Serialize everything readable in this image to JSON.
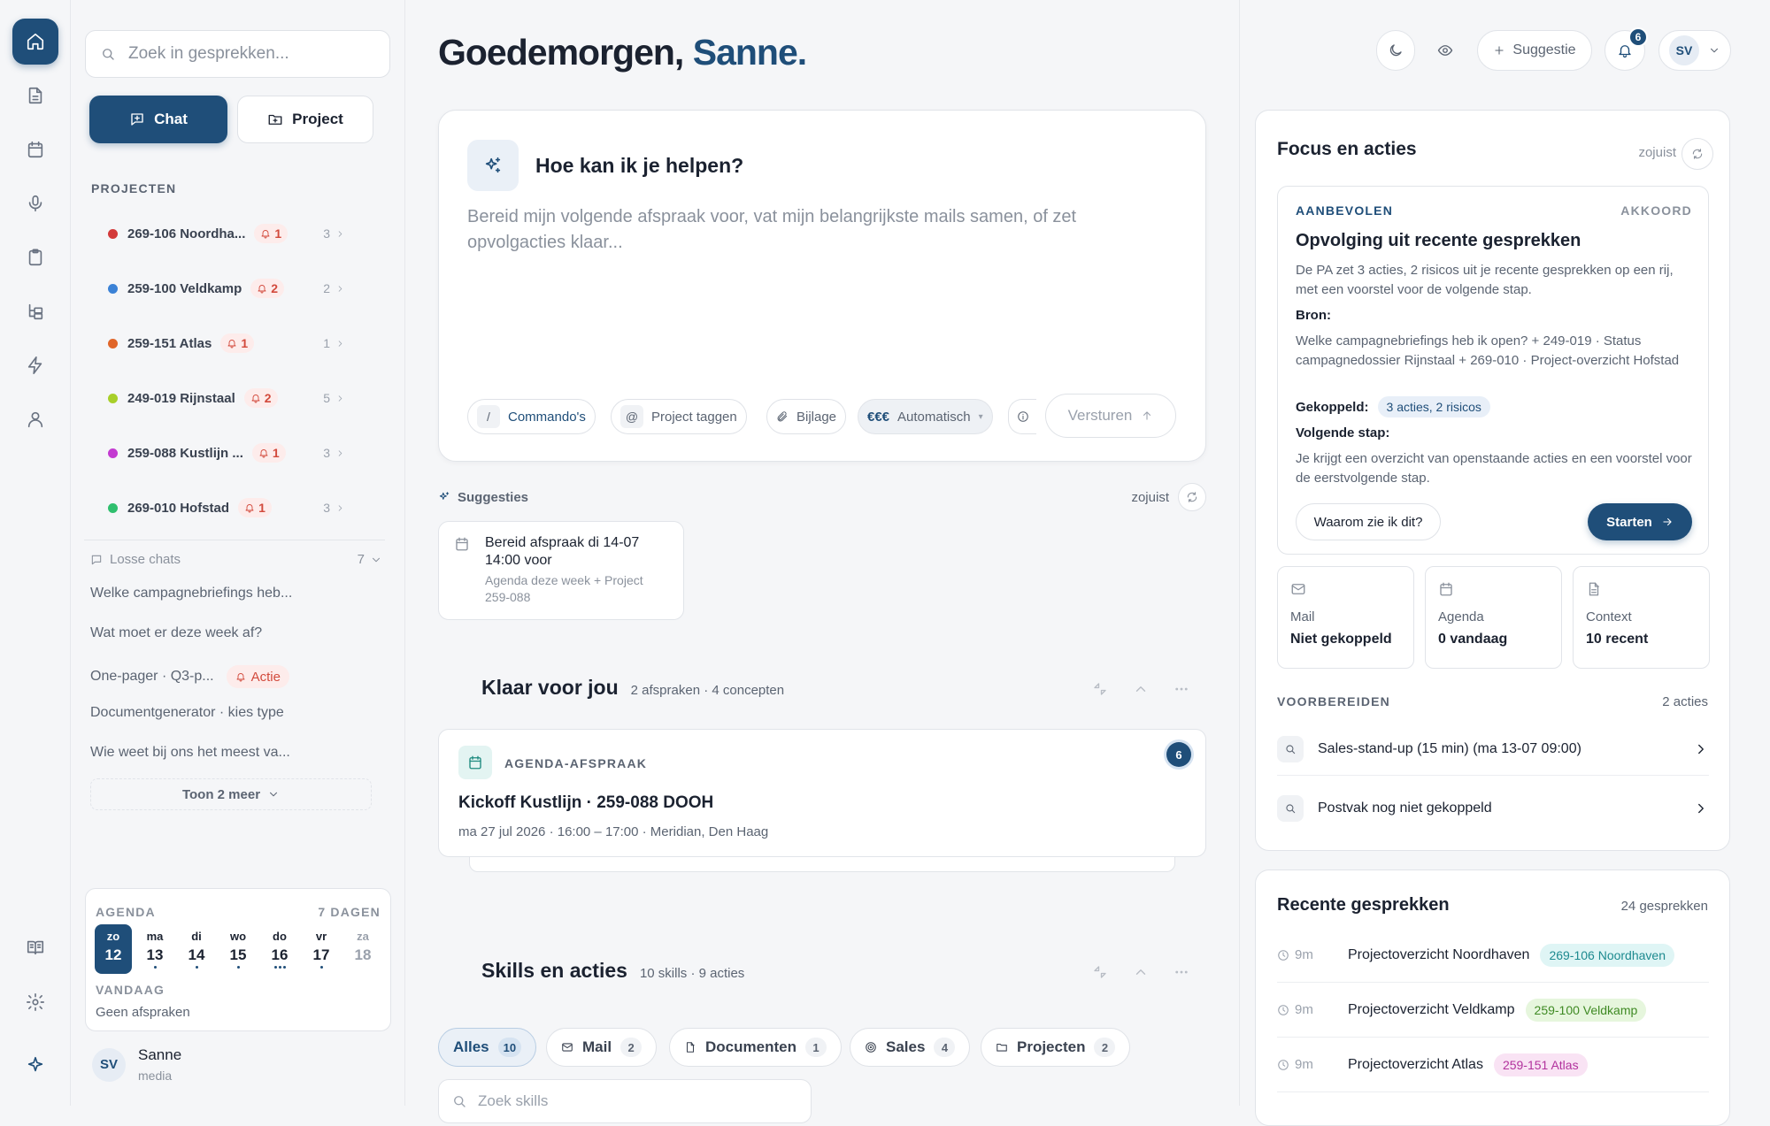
{
  "rail": {
    "items": [
      "home-icon",
      "document-icon",
      "calendar-icon",
      "microphone-icon",
      "clipboard-icon",
      "hierarchy-icon",
      "lightning-icon",
      "user-icon"
    ],
    "bottom": [
      "book-icon",
      "gear-icon",
      "sparkle-icon"
    ]
  },
  "sidebar": {
    "search_placeholder": "Zoek in gesprekken...",
    "chat_label": "Chat",
    "project_label": "Project",
    "projects_heading": "PROJECTEN",
    "projects": [
      {
        "name": "269-106 Noordha...",
        "alerts": "1",
        "count": "3",
        "color": "#d33a3a"
      },
      {
        "name": "259-100 Veldkamp",
        "alerts": "2",
        "count": "2",
        "color": "#3b82d6"
      },
      {
        "name": "259-151 Atlas",
        "alerts": "1",
        "count": "1",
        "color": "#e0662a"
      },
      {
        "name": "249-019 Rijnstaal",
        "alerts": "2",
        "count": "5",
        "color": "#a8cf2a"
      },
      {
        "name": "259-088 Kustlijn ...",
        "alerts": "1",
        "count": "3",
        "color": "#c33ad1"
      },
      {
        "name": "269-010 Hofstad",
        "alerts": "1",
        "count": "3",
        "color": "#2fbf6e"
      }
    ],
    "loose_heading": "Losse chats",
    "loose_count": "7",
    "loose_chats": [
      {
        "title": "Welke campagnebriefings heb..."
      },
      {
        "title": "Wat moet er deze week af?"
      },
      {
        "title": "One-pager · Q3-p...",
        "badge": "Actie"
      },
      {
        "title": "Documentgenerator · kies type"
      },
      {
        "title": "Wie weet bij ons het meest va..."
      }
    ],
    "show_more": "Toon 2 meer",
    "agenda": {
      "label": "AGENDA",
      "range": "7 DAGEN",
      "days": [
        {
          "name": "zo",
          "num": "12",
          "dots": 0,
          "selected": true
        },
        {
          "name": "ma",
          "num": "13",
          "dots": 1
        },
        {
          "name": "di",
          "num": "14",
          "dots": 1
        },
        {
          "name": "wo",
          "num": "15",
          "dots": 1
        },
        {
          "name": "do",
          "num": "16",
          "dots": 3
        },
        {
          "name": "vr",
          "num": "17",
          "dots": 1
        },
        {
          "name": "za",
          "num": "18",
          "dots": 0,
          "muted": true
        }
      ],
      "today_label": "VANDAAG",
      "today_text": "Geen afspraken"
    },
    "user": {
      "initials": "SV",
      "name": "Sanne",
      "org": "media"
    }
  },
  "main": {
    "greeting": "Goedemorgen,",
    "greeting_name": "Sanne.",
    "composer": {
      "title": "Hoe kan ik je helpen?",
      "placeholder": "Bereid mijn volgende afspraak voor, vat mijn belangrijkste mails samen, of zet opvolgacties klaar...",
      "commands_key": "/",
      "commands": "Commando's",
      "tag_key": "@",
      "tag": "Project taggen",
      "attachment": "Bijlage",
      "model_key": "€€€",
      "model": "Automatisch",
      "send": "Versturen"
    },
    "suggestions": {
      "heading": "Suggesties",
      "time": "zojuist",
      "card_title": "Bereid afspraak di 14-07 14:00 voor",
      "card_sub": "Agenda deze week + Project 259-088"
    },
    "ready": {
      "heading": "Klaar voor jou",
      "sub": "2 afspraken · 4 concepten",
      "card_type": "AGENDA-AFSPRAAK",
      "card_badge": "6",
      "card_title": "Kickoff Kustlijn · 259-088 DOOH",
      "card_meta": "ma 27 jul 2026 · 16:00 – 17:00 · Meridian, Den Haag"
    },
    "skills": {
      "heading": "Skills en acties",
      "sub": "10 skills · 9 acties",
      "tabs": [
        {
          "label": "Alles",
          "n": "10"
        },
        {
          "label": "Mail",
          "n": "2"
        },
        {
          "label": "Documenten",
          "n": "1"
        },
        {
          "label": "Sales",
          "n": "4"
        },
        {
          "label": "Projecten",
          "n": "2"
        }
      ],
      "search_placeholder": "Zoek skills"
    }
  },
  "topbar": {
    "suggest": "Suggestie",
    "notif_count": "6",
    "initials": "SV"
  },
  "focus": {
    "heading": "Focus en acties",
    "time": "zojuist",
    "rec_label": "AANBEVOLEN",
    "rec_status": "AKKOORD",
    "rec_title": "Opvolging uit recente gesprekken",
    "rec_desc": "De PA zet 3 acties, 2 risicos uit je recente gesprekken op een rij, met een voorstel voor de volgende stap.",
    "source_label": "Bron:",
    "source_text": "Welke campagnebriefings heb ik open? + 249-019 · Status campagnedossier Rijnstaal + 269-010 · Project-overzicht Hofstad",
    "linked_label": "Gekoppeld:",
    "linked_value": "3 acties, 2 risicos",
    "next_label": "Volgende stap:",
    "next_text": "Je krijgt een overzicht van openstaande acties en een voorstel voor de eerstvolgende stap.",
    "why": "Waarom zie ik dit?",
    "start": "Starten",
    "tiles": [
      {
        "label": "Mail",
        "value": "Niet gekoppeld",
        "icon": "mail-icon"
      },
      {
        "label": "Agenda",
        "value": "0 vandaag",
        "icon": "calendar-icon"
      },
      {
        "label": "Context",
        "value": "10 recent",
        "icon": "document-icon"
      }
    ],
    "prep_label": "VOORBEREIDEN",
    "prep_count": "2 acties",
    "prep_items": [
      "Sales-stand-up (15 min) (ma 13-07 09:00)",
      "Postvak nog niet gekoppeld"
    ]
  },
  "recent": {
    "heading": "Recente gesprekken",
    "count": "24 gesprekken",
    "items": [
      {
        "time": "9m",
        "title": "Projectoverzicht Noordhaven",
        "tag": "269-106 Noordhaven",
        "bg": "#dff5f5",
        "fg": "#1d8a8f"
      },
      {
        "time": "9m",
        "title": "Projectoverzicht Veldkamp",
        "tag": "259-100 Veldkamp",
        "bg": "#e6f6dd",
        "fg": "#3f8a24"
      },
      {
        "time": "9m",
        "title": "Projectoverzicht Atlas",
        "tag": "259-151 Atlas",
        "bg": "#f9e3f4",
        "fg": "#b2329d"
      }
    ]
  },
  "colors": {
    "accent": "#1f4e79",
    "alert": "#d24a3c"
  }
}
